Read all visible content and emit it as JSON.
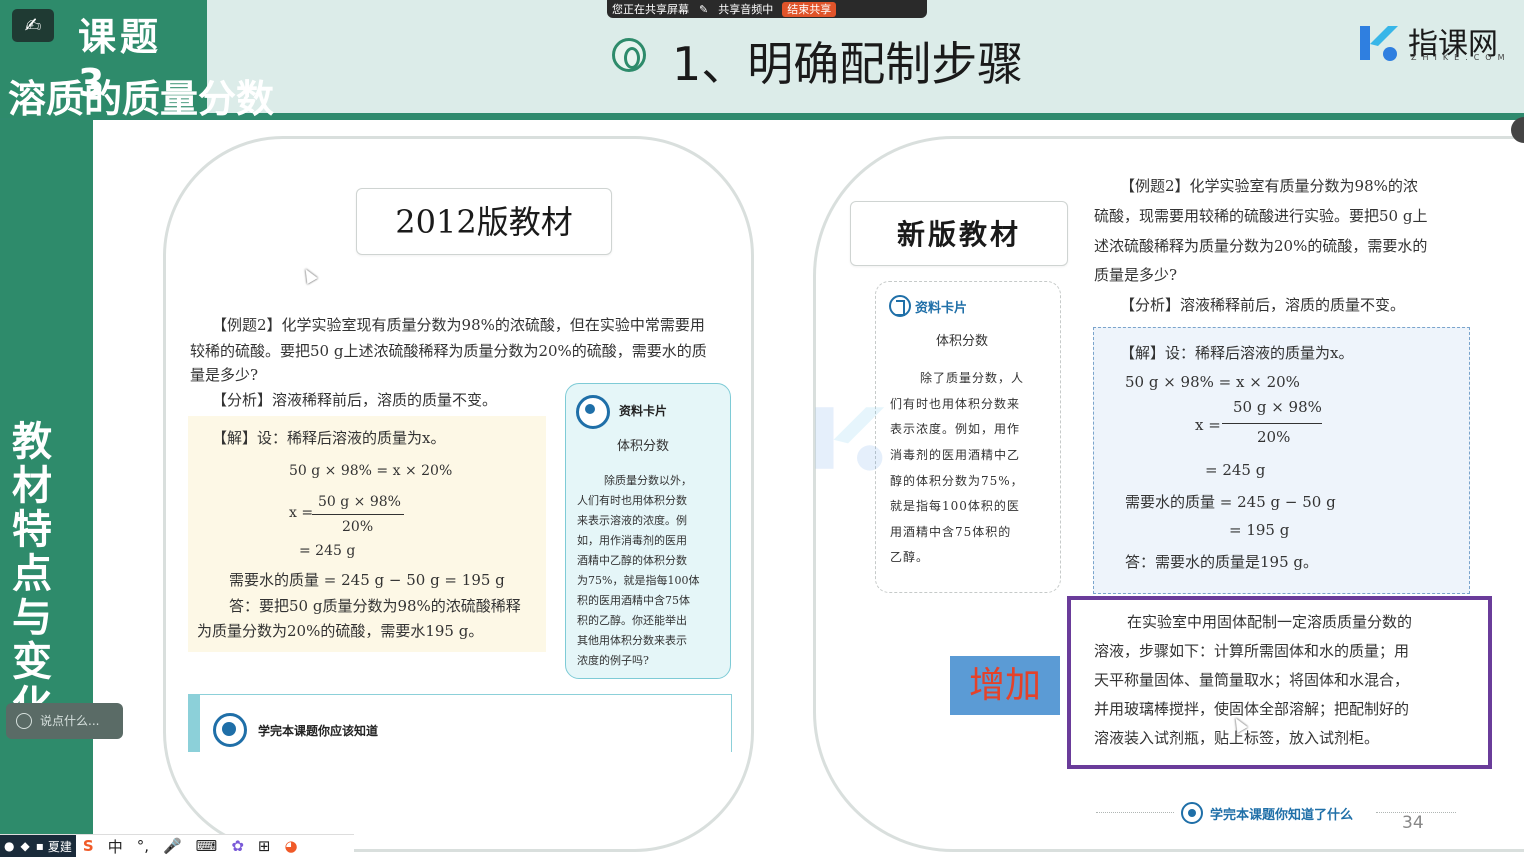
{
  "header": {
    "topic_logo": "✍",
    "topic_number": "课题 3",
    "topic_subtitle": "溶质的质量分数",
    "page_title": "1、明确配制步骤",
    "brand_name": "指课网",
    "brand_sub": "ZHIKE.COM"
  },
  "share_bar": {
    "sharing": "您正在共享屏幕",
    "audio": "共享音频中",
    "end": "结束共享"
  },
  "sidebar": {
    "vertical_title": "教材特点与变化",
    "chat_placeholder": "说点什么..."
  },
  "left_panel": {
    "label": "2012版教材",
    "example_lines": [
      "【例题2】化学实验室现有质量分数为98%的浓硫酸，但在实验中常需要用",
      "较稀的硫酸。要把50 g上述浓硫酸稀释为质量分数为20%的硫酸，需要水的质",
      "量是多少?",
      "【分析】溶液稀释前后，溶质的质量不变。"
    ],
    "solution_lines": [
      "【解】设：稀释后溶液的质量为x。",
      "50 g × 98% = x × 20%",
      "x =",
      "50 g × 98%",
      "20%",
      "= 245 g",
      "需要水的质量 = 245 g − 50 g = 195 g",
      "答：要把50 g质量分数为98%的浓硫酸稀释",
      "为质量分数为20%的硫酸，需要水195 g。"
    ],
    "card_title": "资料卡片",
    "card_heading": "体积分数",
    "card_lines": [
      "除质量分数以外，",
      "人们有时也用体积分数",
      "来表示溶液的浓度。例",
      "如，用作消毒剂的医用",
      "酒精中乙醇的体积分数",
      "为75%，就是指每100体",
      "积的医用酒精中含75体",
      "积的乙醇。你还能举出",
      "其他用体积分数来表示",
      "浓度的例子吗?"
    ],
    "bottom_bar": "学完本课题你应该知道"
  },
  "right_panel": {
    "label": "新版教材",
    "card_title": "资料卡片",
    "card_heading": "体积分数",
    "card_lines": [
      "除了质量分数，人",
      "们有时也用体积分数来",
      "表示浓度。例如，用作",
      "消毒剂的医用酒精中乙",
      "醇的体积分数为75%，",
      "就是指每100体积的医",
      "用酒精中含75体积的",
      "乙醇。"
    ],
    "example_lines": [
      "【例题2】化学实验室有质量分数为98%的浓",
      "硫酸，现需要用较稀的硫酸进行实验。要把50 g上",
      "述浓硫酸稀释为质量分数为20%的硫酸，需要水的",
      "质量是多少?",
      "【分析】溶液稀释前后，溶质的质量不变。"
    ],
    "solution_lines": [
      "【解】设：稀释后溶液的质量为x。",
      "50 g × 98% = x × 20%",
      "x =",
      "50 g × 98%",
      "20%",
      "= 245 g",
      "需要水的质量 = 245 g − 50 g",
      "= 195 g",
      "答：需要水的质量是195 g。"
    ],
    "added_lines": [
      "在实验室中用固体配制一定溶质质量分数的",
      "溶液，步骤如下：计算所需固体和水的质量；用",
      "天平称量固体、量筒量取水；将固体和水混合，",
      "并用玻璃棒搅拌，使固体全部溶解；把配制好的",
      "溶液装入试剂瓶，贴上标签，放入试剂柜。"
    ],
    "add_button": "增加",
    "footer_text": "学完本课题你知道了什么",
    "page_number": "34"
  },
  "taskbar": {
    "app_label": "夏建",
    "ime_lang": "中",
    "ime_punct": "°,"
  },
  "colors": {
    "accent_green": "#2e8b6b",
    "purple_border": "#6a3c9a",
    "add_button_bg": "#5b9bd5",
    "add_button_text": "#e4422a"
  }
}
